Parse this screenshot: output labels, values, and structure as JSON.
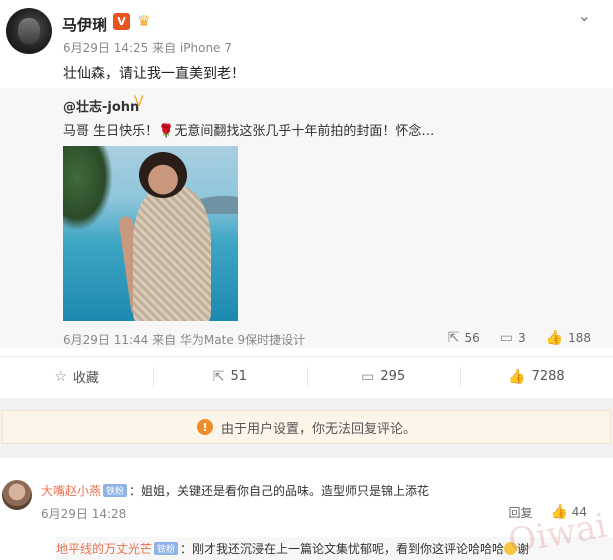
{
  "post": {
    "author": "马伊琍",
    "meta": "6月29日 14:25 来自 iPhone 7",
    "text": "壮仙森，请让我一直美到老！"
  },
  "repost": {
    "author": "@壮志-john",
    "text_before": "马哥 生日快乐！",
    "text_after": "无意间翻找这张几乎十年前拍的封面！怀念…",
    "meta": "6月29日 11:44 来自 华为Mate 9保时捷设计",
    "shares": "56",
    "comments": "3",
    "likes": "188"
  },
  "actions": {
    "favorite": "收藏",
    "shares": "51",
    "comments": "295",
    "likes": "7288"
  },
  "notice": "由于用户设置，你无法回复评论。",
  "comments": [
    {
      "user": "大嘴赵小燕",
      "badge": "铁粉",
      "text": "：姐姐，关键还是看你自己的品味。造型师只是锦上添花",
      "time": "6月29日 14:28",
      "reply_label": "回复",
      "likes": "44"
    },
    {
      "user": "地平线的万丈光芒",
      "badge": "铁粉",
      "text": "：刚才我还沉浸在上一篇论文集忧郁呢，看到你这评论哈哈哈",
      "tail": "谢"
    }
  ],
  "watermark": "Oiwai",
  "colors": {
    "accent": "#eb7350",
    "verified": "#e8541e",
    "notice_bg": "#fdf4ea"
  }
}
